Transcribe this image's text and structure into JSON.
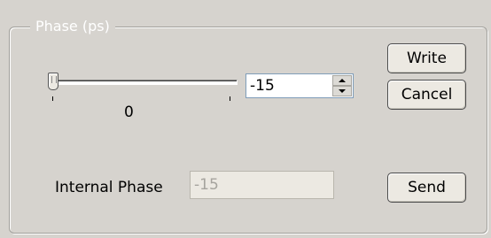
{
  "group": {
    "legend": "Phase (ps)"
  },
  "slider": {
    "label": "0",
    "value_fraction": 0.0
  },
  "spin": {
    "value": "-15"
  },
  "buttons": {
    "write": "Write",
    "cancel": "Cancel",
    "send": "Send"
  },
  "internal": {
    "label": "Internal Phase",
    "value": "-15"
  }
}
